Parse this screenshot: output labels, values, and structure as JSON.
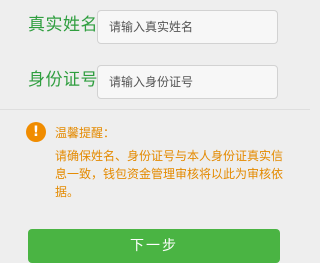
{
  "form": {
    "name_label": "真实姓名",
    "name_placeholder": "请输入真实姓名",
    "id_label": "身份证号",
    "id_placeholder": "请输入身份证号"
  },
  "notice": {
    "icon": "!",
    "icon_name": "warning-icon",
    "title": "温馨提醒：",
    "text": "请确保姓名、身份证号与本人身份证真实信息一致，钱包资金管理审核将以此为审核依据。"
  },
  "actions": {
    "next_label": "下一步"
  },
  "colors": {
    "label_green": "#2f9e3f",
    "notice_orange": "#e48a00",
    "button_green": "#4ab443",
    "background": "#eeeeee"
  }
}
